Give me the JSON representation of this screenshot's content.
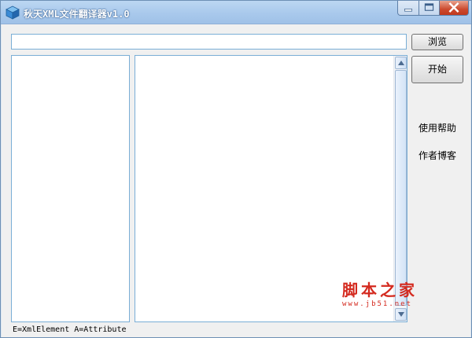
{
  "window": {
    "title": "秋天XML文件翻译器v1.0",
    "icons": {
      "app": "cube-app-icon",
      "minimize": "minimize-icon",
      "maximize": "maximize-icon",
      "close": "close-icon"
    }
  },
  "toolbar": {
    "path_value": "",
    "browse_label": "浏览",
    "start_label": "开始"
  },
  "side_links": {
    "help": "使用帮助",
    "blog": "作者博客"
  },
  "legend": "E=XmlElement   A=Attribute",
  "watermark": {
    "title": "脚本之家",
    "url": "www.jb51.net"
  },
  "colors": {
    "title_bar": "#a9c9ec",
    "panel_border": "#7aaed6",
    "close_button": "#cc4a2e",
    "watermark": "#d42a1f"
  }
}
